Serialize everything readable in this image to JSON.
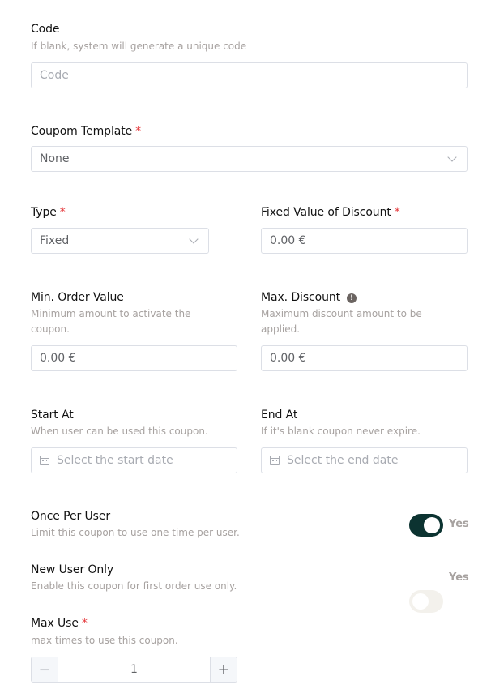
{
  "code": {
    "label": "Code",
    "hint": "If blank, system will generate a unique code",
    "placeholder": "Code",
    "value": ""
  },
  "template": {
    "label": "Coupom Template",
    "required": "*",
    "selected": "None"
  },
  "type": {
    "label": "Type",
    "required": "*",
    "selected": "Fixed"
  },
  "fixed_value": {
    "label": "Fixed Value of Discount",
    "required": "*",
    "value": "0.00 €"
  },
  "min_order": {
    "label": "Min. Order Value",
    "hint": "Minimum amount to activate the coupon.",
    "value": "0.00 €"
  },
  "max_discount": {
    "label": "Max. Discount",
    "info_icon": "!",
    "hint": "Maximum discount amount to be applied.",
    "value": "0.00 €"
  },
  "start_at": {
    "label": "Start At",
    "hint": "When user can be used this coupon.",
    "placeholder": "Select the start date"
  },
  "end_at": {
    "label": "End At",
    "hint": "If it's blank coupon never expire.",
    "placeholder": "Select the end date"
  },
  "once_per_user": {
    "label": "Once Per User",
    "hint": "Limit this coupon to use one time per user.",
    "toggle_text": "Yes",
    "enabled": true
  },
  "new_user_only": {
    "label": "New User Only",
    "hint": "Enable this coupon for first order use only.",
    "toggle_text": "Yes",
    "enabled": false
  },
  "max_use": {
    "label": "Max Use",
    "required": "*",
    "hint": "max times to use this coupon.",
    "value": "1",
    "minus": "−",
    "plus": "+"
  },
  "colors": {
    "accent": "#0c3331",
    "required": "#e5383b",
    "toggle_off": "#f3f1ec"
  }
}
